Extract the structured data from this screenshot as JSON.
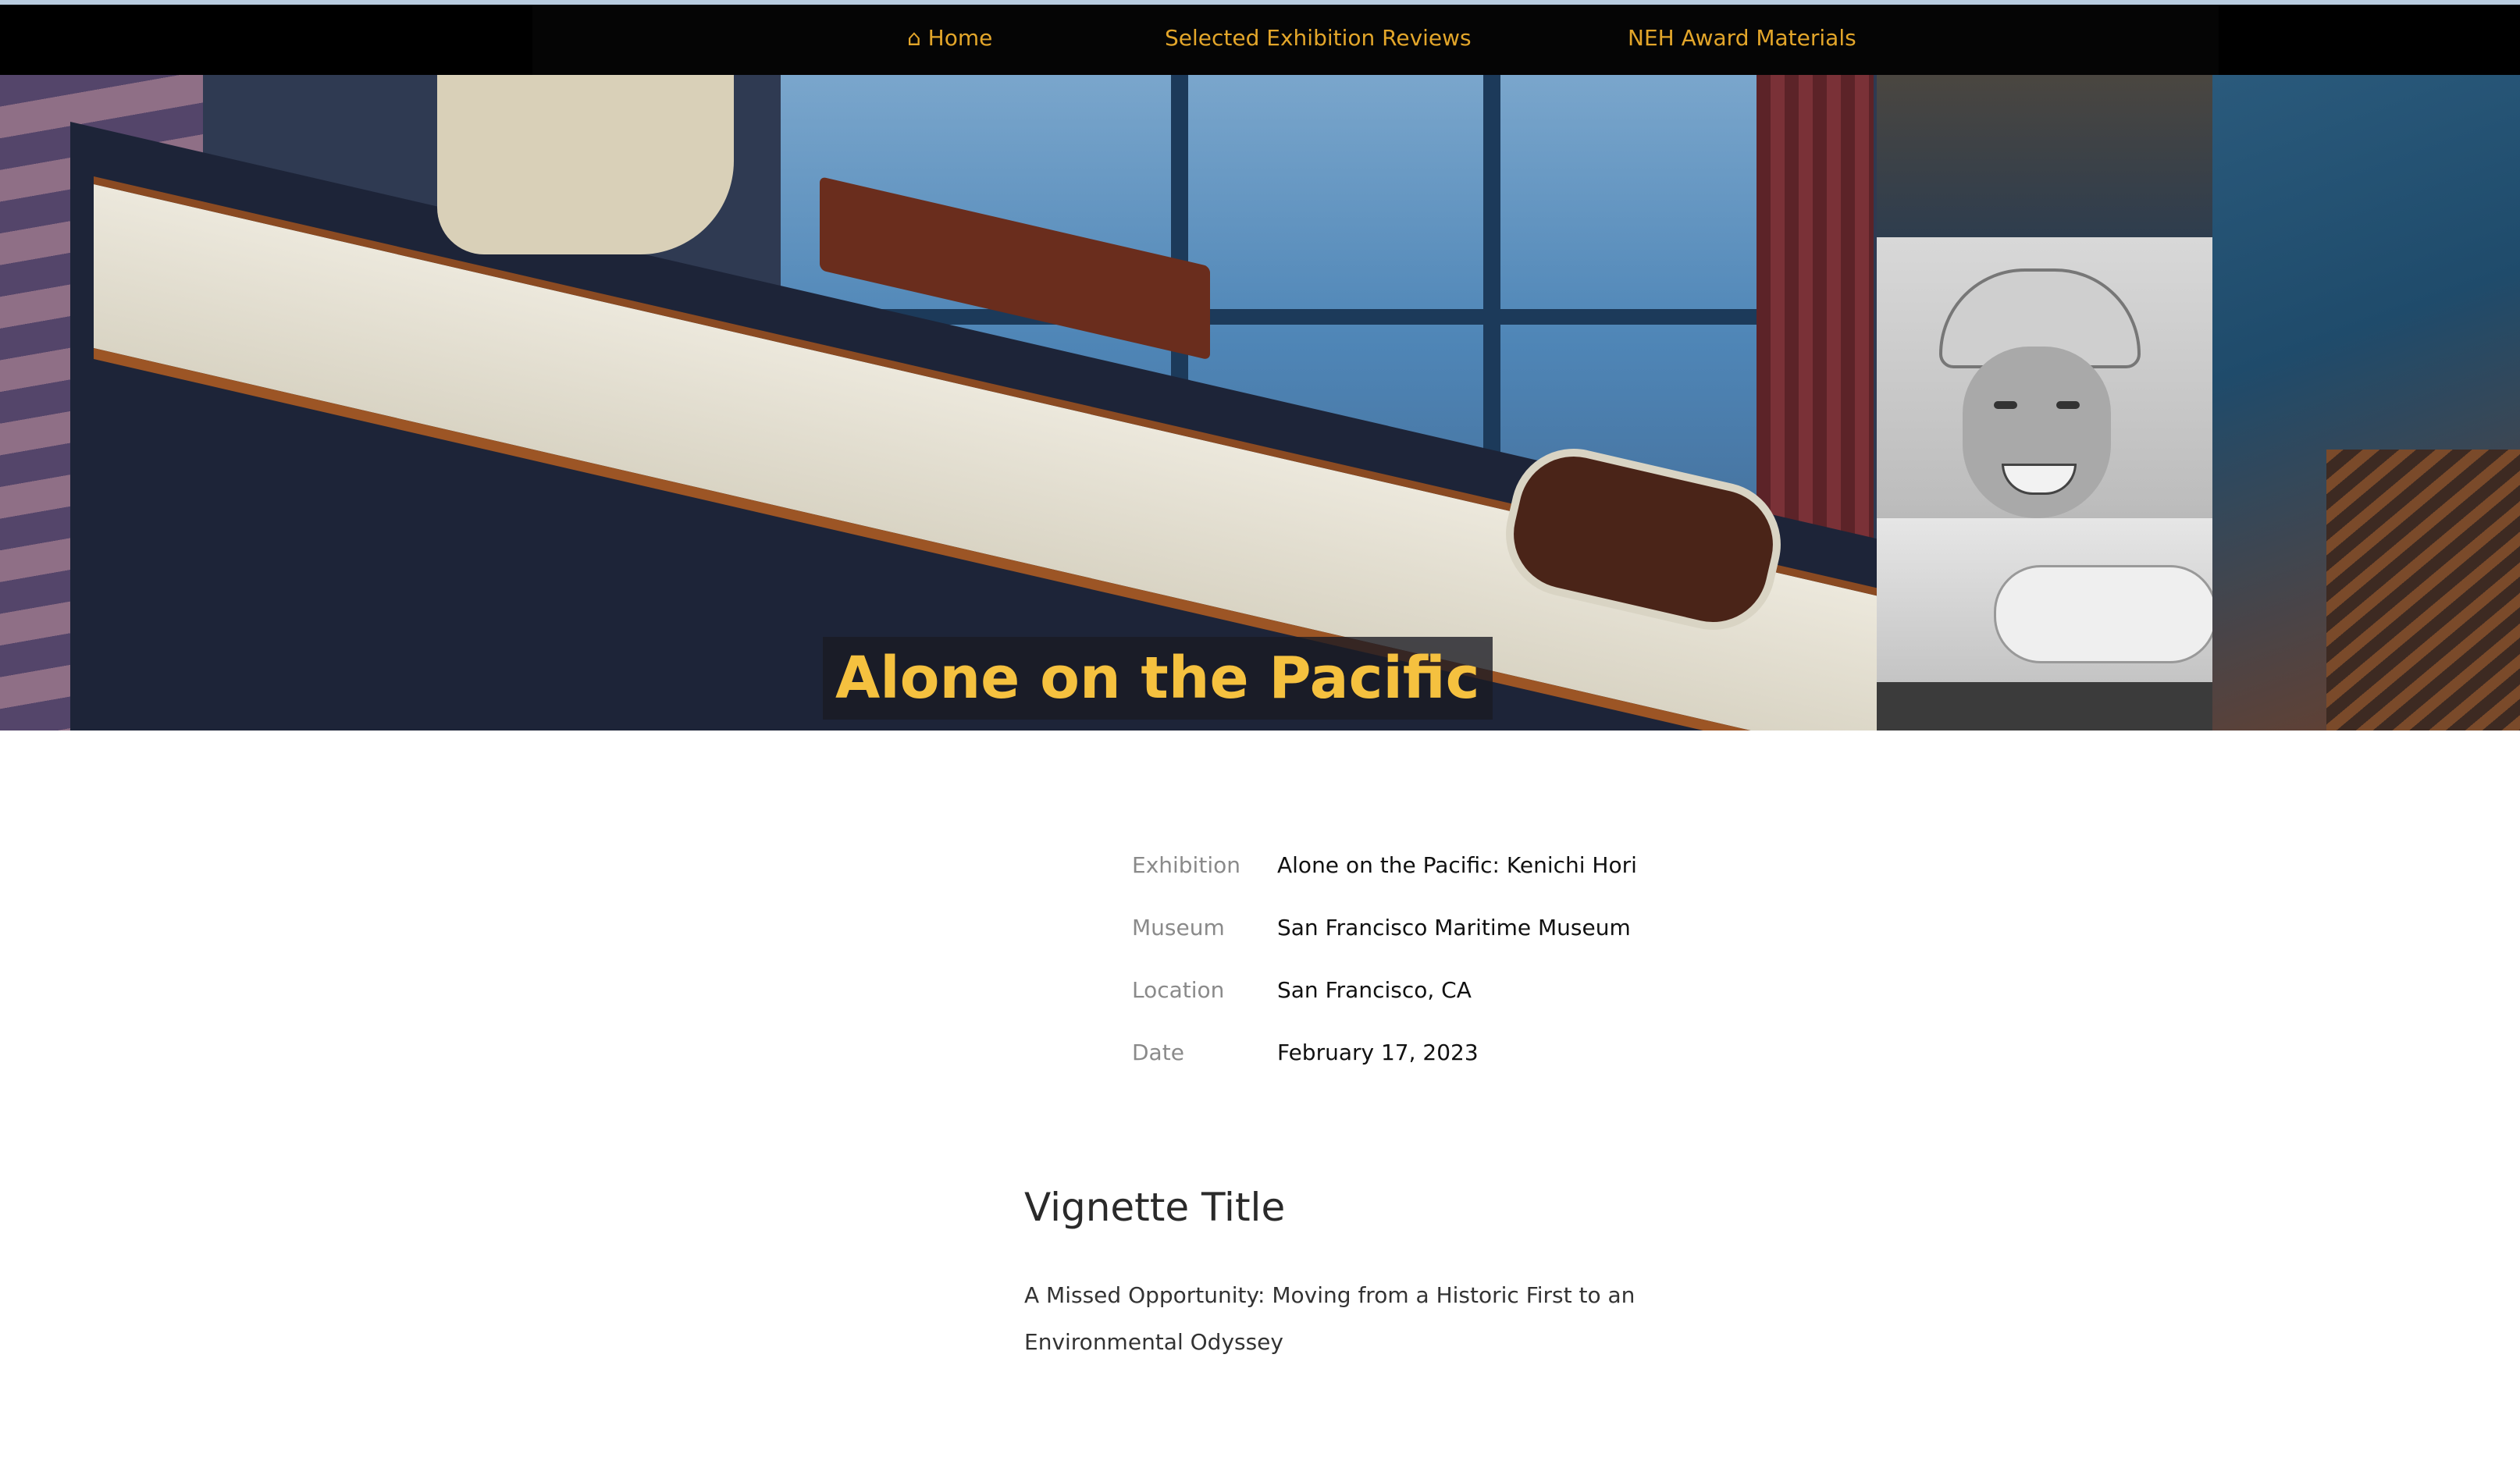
{
  "nav": {
    "home_label": "⌂ Home",
    "reviews_label": "Selected Exhibition Reviews",
    "neh_label": "NEH Award Materials"
  },
  "hero": {
    "title": "Alone on the Pacific"
  },
  "info": {
    "rows": [
      {
        "label": "Exhibition",
        "value": "Alone on the Pacific: Kenichi Hori"
      },
      {
        "label": "Museum",
        "value": "San Francisco Maritime Museum"
      },
      {
        "label": "Location",
        "value": "San Francisco, CA"
      },
      {
        "label": "Date",
        "value": "February 17, 2023"
      }
    ]
  },
  "vignette": {
    "heading": "Vignette Title",
    "text": "A Missed Opportunity: Moving from a Historic First to an Environmental Odyssey"
  },
  "colors": {
    "nav_link": "#e3a62a",
    "hero_title": "#f5c13f",
    "nav_background": "#000000"
  }
}
